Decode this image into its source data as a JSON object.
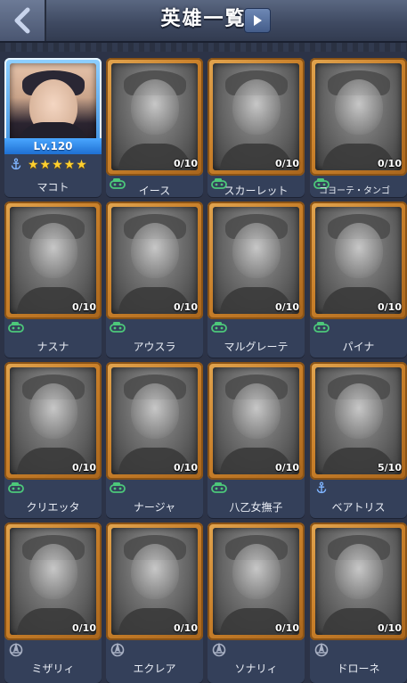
{
  "header": {
    "title": "英雄一覧"
  },
  "featured": {
    "level": "Lv.120",
    "stars": "★★★★★",
    "name": "マコト",
    "icon": "anchor-icon"
  },
  "heroes": [
    {
      "name": "イース",
      "progress": "0/10",
      "icon": "tank-icon"
    },
    {
      "name": "スカーレット",
      "progress": "0/10",
      "icon": "tank-icon"
    },
    {
      "name": "コヨーテ・タンゴ",
      "progress": "0/10",
      "icon": "tank-icon"
    },
    {
      "name": "ナスナ",
      "progress": "0/10",
      "icon": "tank-icon"
    },
    {
      "name": "アウスラ",
      "progress": "0/10",
      "icon": "tank-icon"
    },
    {
      "name": "マルグレーテ",
      "progress": "0/10",
      "icon": "tank-icon"
    },
    {
      "name": "パイナ",
      "progress": "0/10",
      "icon": "tank-icon"
    },
    {
      "name": "クリエッタ",
      "progress": "0/10",
      "icon": "tank-icon"
    },
    {
      "name": "ナージャ",
      "progress": "0/10",
      "icon": "tank-icon"
    },
    {
      "name": "八乙女撫子",
      "progress": "0/10",
      "icon": "tank-icon"
    },
    {
      "name": "ベアトリス",
      "progress": "5/10",
      "icon": "anchor-icon"
    },
    {
      "name": "ミザリィ",
      "progress": "0/10",
      "icon": "aircraft-icon"
    },
    {
      "name": "エクレア",
      "progress": "0/10",
      "icon": "aircraft-icon"
    },
    {
      "name": "ソナリィ",
      "progress": "0/10",
      "icon": "aircraft-icon"
    },
    {
      "name": "ドローネ",
      "progress": "0/10",
      "icon": "aircraft-icon"
    }
  ]
}
